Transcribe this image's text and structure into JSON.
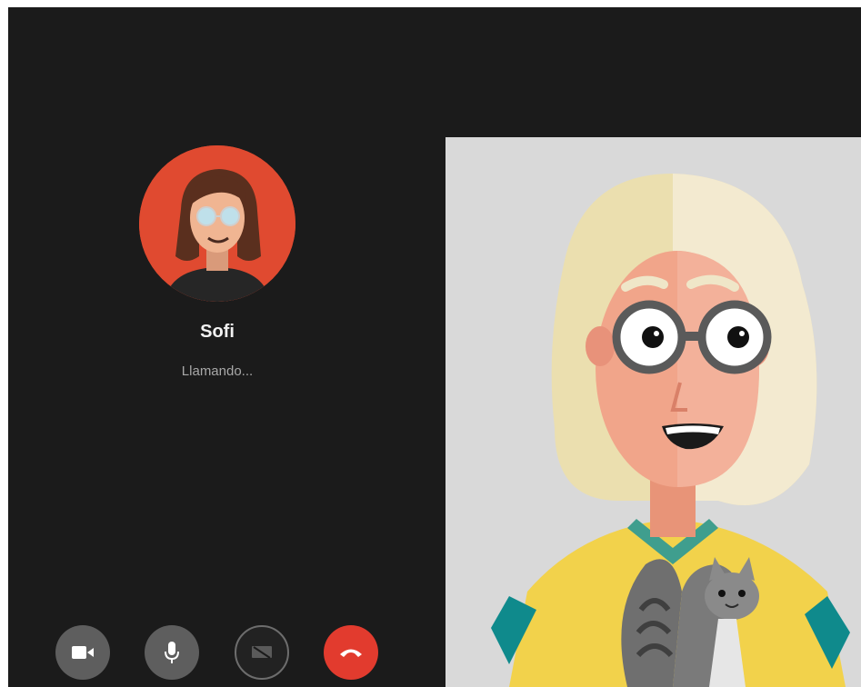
{
  "call": {
    "caller_name": "Sofi",
    "status": "Llamando..."
  },
  "controls": {
    "video": "video-camera-icon",
    "mic": "microphone-icon",
    "screen": "screen-share-icon",
    "hangup": "hang-up-icon"
  },
  "colors": {
    "background": "#1b1b1b",
    "avatar_bg": "#e04a30",
    "control_bg": "#5e5e5e",
    "hangup": "#e23b2e",
    "self_view_bg": "#d9d9d9"
  }
}
